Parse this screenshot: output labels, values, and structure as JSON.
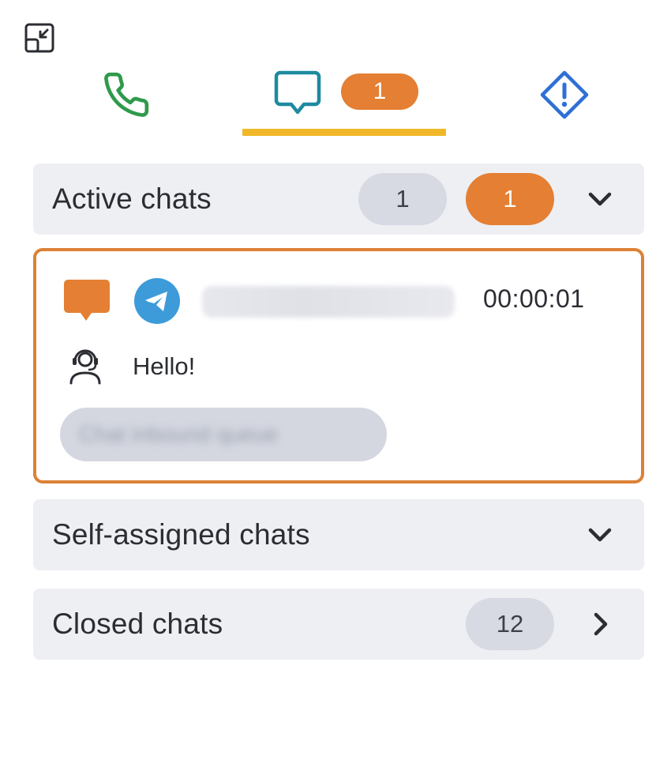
{
  "tabs": {
    "chats_badge": "1"
  },
  "sections": {
    "active": {
      "title": "Active chats",
      "count_gray": "1",
      "count_orange": "1"
    },
    "self_assigned": {
      "title": "Self-assigned chats"
    },
    "closed": {
      "title": "Closed chats",
      "count": "12"
    }
  },
  "chat": {
    "timer": "00:00:01",
    "last_message": "Hello!",
    "queue_tag": "Chat inbound queue"
  },
  "colors": {
    "accent_orange": "#e47f33",
    "tab_underline": "#f0b829",
    "phone_green": "#2f9a4c",
    "chat_teal": "#1e8aa0",
    "alert_blue": "#2f6fd6",
    "telegram_blue": "#3d9bd9"
  },
  "icons": {
    "collapse": "collapse-icon",
    "phone": "phone-icon",
    "chat": "chat-bubble-icon",
    "alert": "alert-diamond-icon",
    "chat_type": "chat-bubble-filled-icon",
    "telegram": "telegram-icon",
    "agent": "agent-headset-icon",
    "chevron_down": "chevron-down-icon",
    "chevron_right": "chevron-right-icon"
  }
}
